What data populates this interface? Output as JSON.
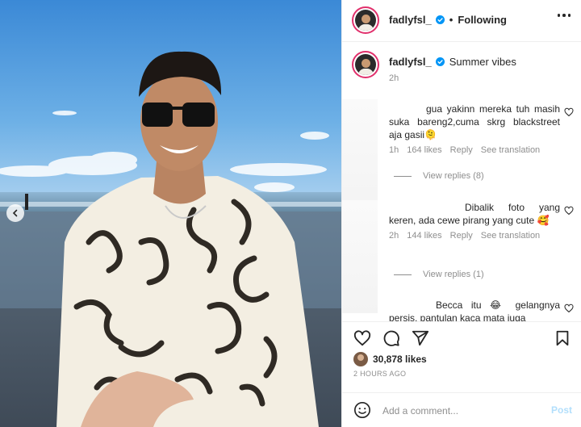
{
  "post": {
    "username": "fadlyfsl_",
    "follow_status": "Following",
    "dot_separator": "•",
    "caption": "Summer vibes",
    "caption_time": "2h",
    "likes": "30,878 likes",
    "posted_ago": "2 HOURS AGO"
  },
  "comments": [
    {
      "text": "gua yakinn mereka tuh masih suka bareng2,cuma skrg blackstreet aja gasii🫠",
      "time": "1h",
      "likes": "164 likes",
      "reply_label": "Reply",
      "translate_label": "See translation",
      "view_replies": "View replies (8)"
    },
    {
      "text": "Dibalik foto yang keren, ada cewe pirang yang cute 🥰",
      "time": "2h",
      "likes": "144 likes",
      "reply_label": "Reply",
      "translate_label": "See translation",
      "view_replies": "View replies (1)"
    },
    {
      "text": "Becca itu 😂 gelangnya persis, pantulan kaca mata juga",
      "time": "",
      "likes": "",
      "reply_label": "",
      "translate_label": "",
      "view_replies": ""
    }
  ],
  "composer": {
    "placeholder": "Add a comment...",
    "post_label": "Post"
  },
  "icons": {
    "verified": "verified-badge-icon",
    "more": "more-options-icon",
    "heart": "heart-icon",
    "comment": "comment-icon",
    "share": "share-icon",
    "save": "bookmark-icon",
    "emoji": "emoji-icon",
    "carousel_prev": "chevron-left-icon"
  },
  "colors": {
    "verified_blue": "#0095f6",
    "story_ring": "#e1306c",
    "post_disabled": "#b2dffc",
    "muted_text": "#8e8e8e"
  }
}
